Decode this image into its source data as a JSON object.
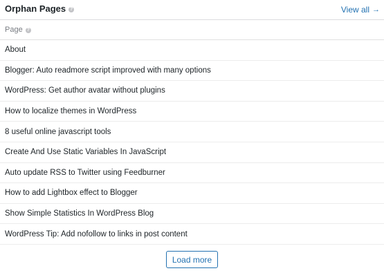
{
  "widget": {
    "title": "Orphan Pages",
    "view_all_label": "View all",
    "view_all_icon": "arrow-right-icon"
  },
  "table": {
    "column_header": "Page",
    "rows": [
      {
        "title": "About"
      },
      {
        "title": "Blogger: Auto readmore script improved with many options"
      },
      {
        "title": "WordPress: Get author avatar without plugins"
      },
      {
        "title": "How to localize themes in WordPress"
      },
      {
        "title": "8 useful online javascript tools"
      },
      {
        "title": "Create And Use Static Variables In JavaScript"
      },
      {
        "title": "Auto update RSS to Twitter using Feedburner"
      },
      {
        "title": "How to add Lightbox effect to Blogger"
      },
      {
        "title": "Show Simple Statistics In WordPress Blog"
      },
      {
        "title": "WordPress Tip: Add nofollow to links in post content"
      }
    ]
  },
  "footer": {
    "load_more_label": "Load more"
  },
  "colors": {
    "accent": "#2271b1",
    "text": "#1d2327",
    "muted": "#787c82",
    "border": "#dcdcde"
  }
}
